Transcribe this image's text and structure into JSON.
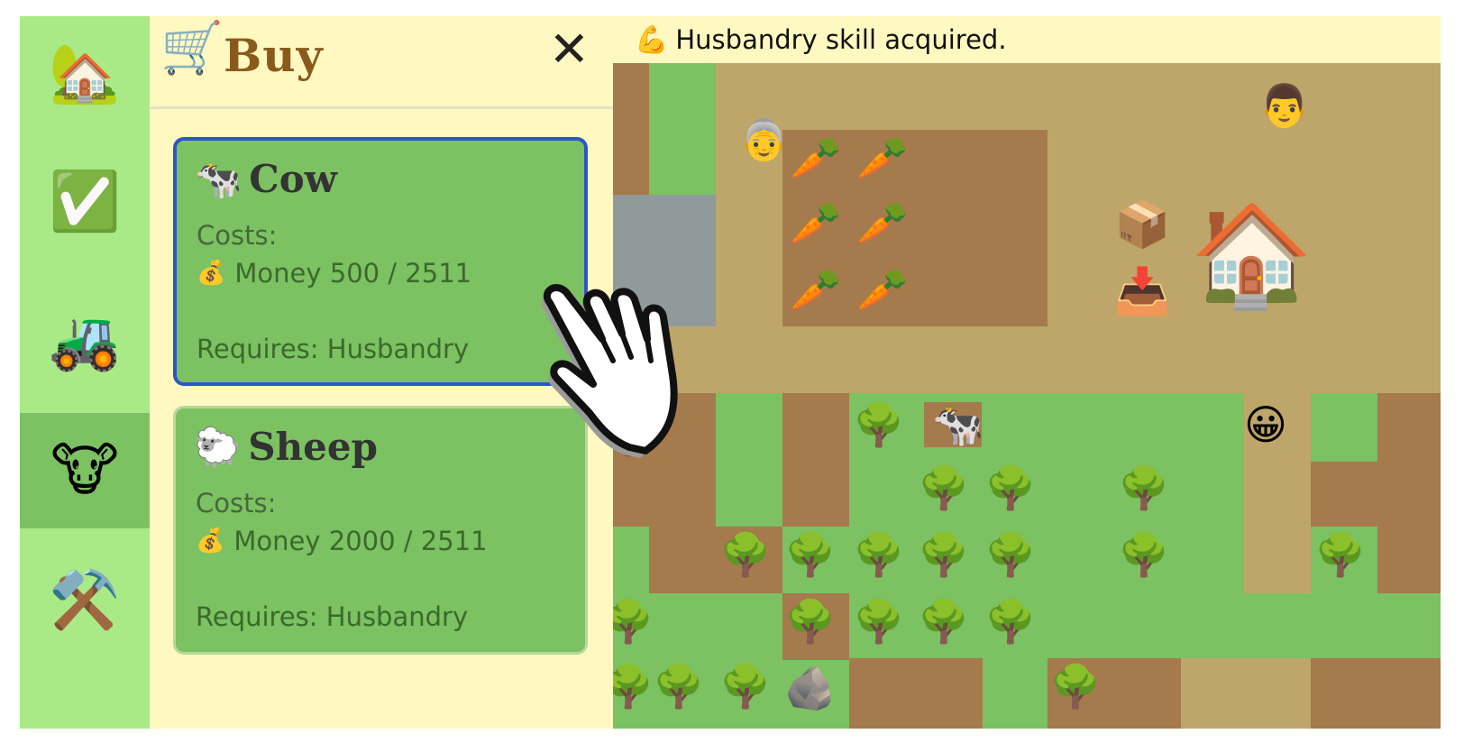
{
  "rail": {
    "items": [
      {
        "icon": "🏡",
        "name": "home"
      },
      {
        "icon": "✅",
        "name": "tasks"
      },
      {
        "icon": "🚜",
        "name": "farming"
      },
      {
        "icon": "🐮",
        "name": "animals",
        "active": true
      },
      {
        "icon": "⚒️",
        "name": "tools"
      }
    ]
  },
  "panel": {
    "cart_icon": "🛒",
    "title": "Buy",
    "close_icon": "✕",
    "cards": [
      {
        "icon": "🐄",
        "name": "Cow",
        "costs_label": "Costs:",
        "money_icon": "💰",
        "money_text": "Money 500 / 2511",
        "requires": "Requires: Husbandry",
        "selected": true
      },
      {
        "icon": "🐑",
        "name": "Sheep",
        "costs_label": "Costs:",
        "money_icon": "💰",
        "money_text": "Money 2000 / 2511",
        "requires": "Requires: Husbandry",
        "selected": false
      }
    ]
  },
  "notification": {
    "icon": "💪",
    "text": "Husbandry skill acquired."
  },
  "map": {
    "colors": {
      "grass": "#7cc162",
      "dirt": "#a57a4d",
      "path": "#bea66a",
      "stone": "#909a9b"
    },
    "emoji": {
      "carrot": "🥕",
      "tree": "🌳",
      "house": "🏠",
      "package": "📦",
      "inbox": "📥",
      "grandma": "👵",
      "farmer": "👨",
      "smiley": "😀",
      "cow": "🐄",
      "rock": "🪨"
    }
  }
}
